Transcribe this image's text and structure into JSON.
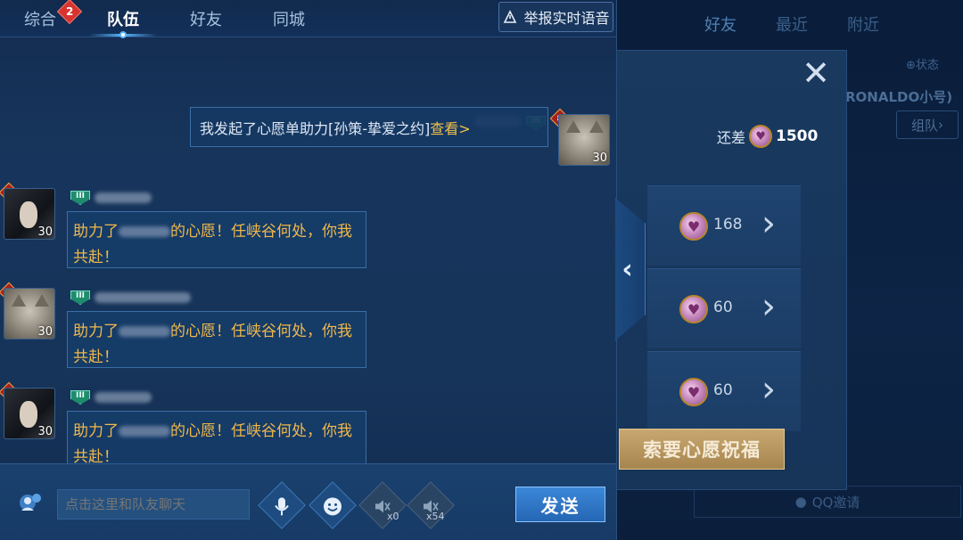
{
  "tabs": [
    {
      "label": "综合",
      "badge": "2"
    },
    {
      "label": "队伍"
    },
    {
      "label": "好友"
    },
    {
      "label": "同城"
    }
  ],
  "report_button": "举报实时语音",
  "messages": {
    "self": {
      "rank": "8",
      "level": "30",
      "text_prefix": "我发起了心愿单助力[孙策-挚爱之约]",
      "link": "查看>"
    },
    "others": [
      {
        "rank": "6",
        "level": "30",
        "vip": "III",
        "text_before": "助力了",
        "text_after": "的心愿！任峡谷何处，你我共赴！"
      },
      {
        "rank": "6",
        "level": "30",
        "vip": "III",
        "text_before": "助力了",
        "text_after": "的心愿！任峡谷何处，你我共赴！"
      },
      {
        "rank": "6",
        "level": "30",
        "vip": "III",
        "text_before": "助力了",
        "text_after": "的心愿！任峡谷何处，你我共赴！"
      }
    ]
  },
  "input": {
    "placeholder": "点击这里和队友聊天",
    "mute_all_count": "x0",
    "speaker_count": "x54",
    "send_label": "发送"
  },
  "background_panel": {
    "tabs": [
      "好友",
      "最近",
      "附近"
    ],
    "status_label": "状态",
    "nickname": "RONALDO小号)",
    "team_button": "组队",
    "need_label": "还差",
    "need_value": "1500",
    "rewards": [
      "168",
      "60",
      "60"
    ],
    "ask_button": "索要心愿祝福",
    "invite_label": "QQ邀请"
  },
  "colors": {
    "accent": "#5ab6ff",
    "highlight_text": "#f0b84a",
    "send_button": "#2f78c8"
  }
}
